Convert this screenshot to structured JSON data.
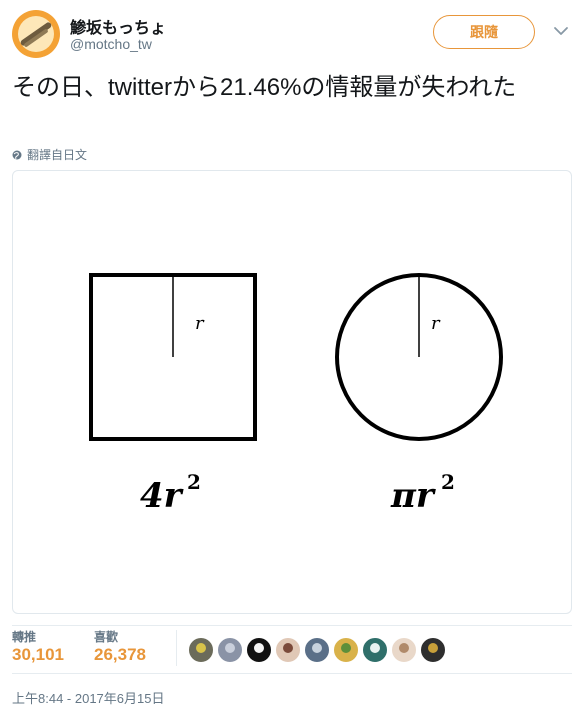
{
  "user": {
    "display_name": "鯵坂もっちょ",
    "handle": "@motcho_tw",
    "avatar_icon": "avatar-image"
  },
  "follow_button": {
    "label": "跟隨"
  },
  "menu": {
    "icon": "chevron-down-icon"
  },
  "tweet": {
    "text": "その日、twitterから21.46%の情報量が失われた"
  },
  "translate": {
    "label": "翻譯自日文",
    "icon": "globe-icon"
  },
  "media": {
    "square_label": "r",
    "circle_label": "r",
    "square_formula_coef": "4r",
    "square_formula_exp": "2",
    "circle_formula_coef": "πr",
    "circle_formula_exp": "2"
  },
  "stats": {
    "retweets_label": "轉推",
    "retweets_value": "30,101",
    "likes_label": "喜歡",
    "likes_value": "26,378"
  },
  "likers": [
    {
      "color": "#6b6b5a",
      "accent": "#d8c34a"
    },
    {
      "color": "#8a93a6",
      "accent": "#c9cfdb"
    },
    {
      "color": "#111111",
      "accent": "#f4f4f4"
    },
    {
      "color": "#e0c8b6",
      "accent": "#7a4a3a"
    },
    {
      "color": "#5a6f88",
      "accent": "#c7d2de"
    },
    {
      "color": "#d9b24a",
      "accent": "#5d8f3a"
    },
    {
      "color": "#2f6f6a",
      "accent": "#e8f2f0"
    },
    {
      "color": "#e9d8c9",
      "accent": "#b08a6a"
    },
    {
      "color": "#2e2e2e",
      "accent": "#c8a03a"
    }
  ],
  "timestamp": "上午8:44 - 2017年6月15日",
  "colors": {
    "accent": "#e8963a",
    "muted": "#657786"
  }
}
